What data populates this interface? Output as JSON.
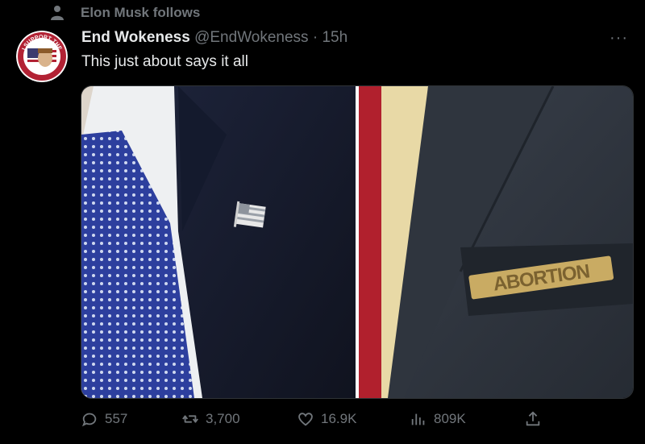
{
  "social_context": {
    "text": "Elon Musk follows",
    "icon": "person-icon"
  },
  "tweet": {
    "display_name": "End Wokeness",
    "handle": "@EndWokeness",
    "separator": "·",
    "time": "15h",
    "text": "This just about says it all",
    "more_label": "···",
    "avatar": {
      "top_text": "I SUPPORT THE",
      "bottom_text": "FORMER THINGS"
    },
    "media": {
      "right_pin_text": "ABORTION"
    }
  },
  "actions": {
    "reply": {
      "icon": "reply-icon",
      "count": "557"
    },
    "retweet": {
      "icon": "retweet-icon",
      "count": "3,700"
    },
    "like": {
      "icon": "heart-icon",
      "count": "16.9K"
    },
    "views": {
      "icon": "views-icon",
      "count": "809K"
    },
    "share": {
      "icon": "share-icon"
    }
  },
  "colors": {
    "background": "#000000",
    "text": "#e7e9ea",
    "secondary": "#71767b"
  }
}
